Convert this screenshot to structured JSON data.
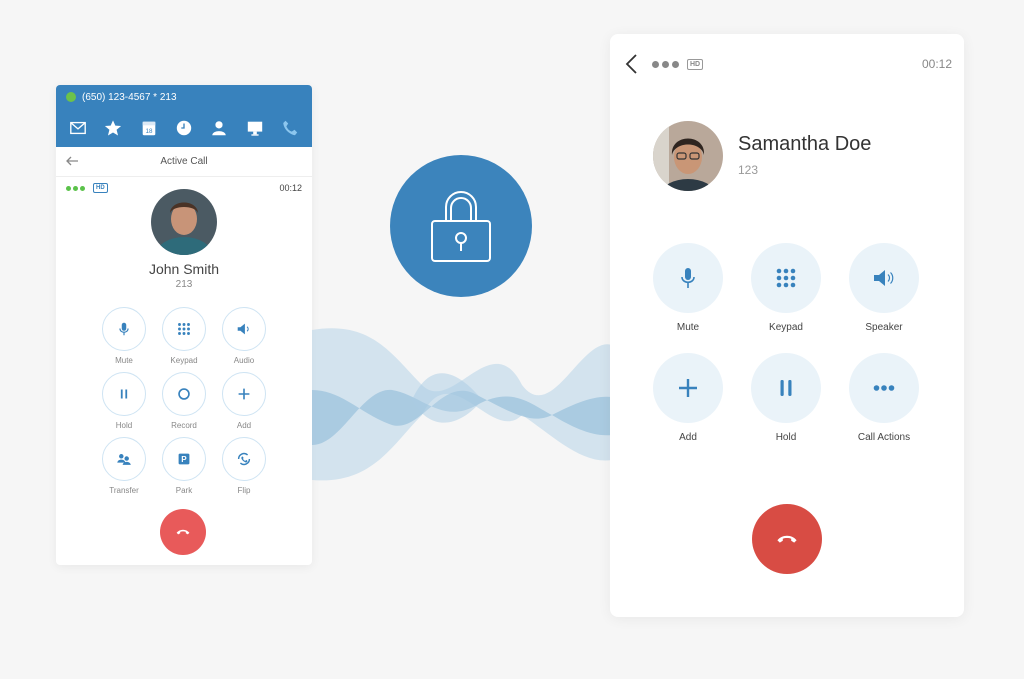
{
  "colors": {
    "brand_blue": "#3882bd",
    "end_call_red": "#d84c44",
    "status_green": "#5bc24a",
    "button_bg": "#eaf3f9"
  },
  "left_phone": {
    "caller_id": "(650) 123-4567 * 213",
    "nav_icons": [
      "mail-icon",
      "star-icon",
      "calendar-icon",
      "clock-icon",
      "contact-icon",
      "monitor-icon",
      "phone-icon"
    ],
    "calendar_day": "18",
    "header_title": "Active Call",
    "hd_badge": "HD",
    "timer": "00:12",
    "contact_name": "John Smith",
    "contact_ext": "213",
    "buttons": [
      {
        "label": "Mute",
        "icon": "microphone-icon"
      },
      {
        "label": "Keypad",
        "icon": "keypad-icon"
      },
      {
        "label": "Audio",
        "icon": "speaker-icon"
      },
      {
        "label": "Hold",
        "icon": "pause-icon"
      },
      {
        "label": "Record",
        "icon": "record-icon"
      },
      {
        "label": "Add",
        "icon": "plus-icon"
      },
      {
        "label": "Transfer",
        "icon": "transfer-icon"
      },
      {
        "label": "Park",
        "icon": "park-icon"
      },
      {
        "label": "Flip",
        "icon": "flip-icon"
      }
    ],
    "park_letter": "P"
  },
  "right_phone": {
    "hd_badge": "HD",
    "timer": "00:12",
    "contact_name": "Samantha Doe",
    "contact_ext": "123",
    "buttons": [
      {
        "label": "Mute",
        "icon": "microphone-icon"
      },
      {
        "label": "Keypad",
        "icon": "keypad-icon"
      },
      {
        "label": "Speaker",
        "icon": "speaker-icon"
      },
      {
        "label": "Add",
        "icon": "plus-icon"
      },
      {
        "label": "Hold",
        "icon": "pause-icon"
      },
      {
        "label": "Call Actions",
        "icon": "more-icon"
      }
    ]
  }
}
